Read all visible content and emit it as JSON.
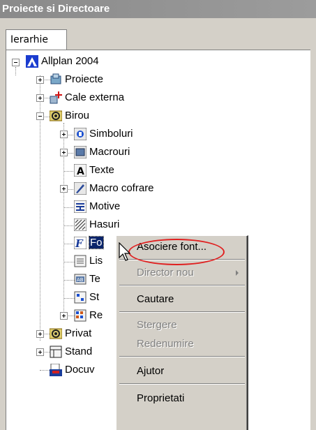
{
  "window": {
    "title": "Proiecte si Directoare"
  },
  "tabs": [
    {
      "label": "Ierarhie"
    }
  ],
  "tree": {
    "root": {
      "label": "Allplan 2004",
      "icon": "allplan-icon"
    },
    "items": [
      {
        "label": "Proiecte",
        "icon": "projects-icon"
      },
      {
        "label": "Cale externa",
        "icon": "external-path-icon"
      },
      {
        "label": "Birou",
        "icon": "office-icon"
      },
      {
        "label": "Simboluri",
        "icon": "symbols-icon"
      },
      {
        "label": "Macrouri",
        "icon": "macros-icon"
      },
      {
        "label": "Texte",
        "icon": "texts-icon"
      },
      {
        "label": "Macro cofrare",
        "icon": "formwork-macro-icon"
      },
      {
        "label": "Motive",
        "icon": "patterns-icon"
      },
      {
        "label": "Hasuri",
        "icon": "hatching-icon"
      },
      {
        "label": "Fo",
        "icon": "fonts-icon"
      },
      {
        "label": "Lis",
        "icon": "lists-icon"
      },
      {
        "label": "Te",
        "icon": "templates-icon"
      },
      {
        "label": "St",
        "icon": "styles-icon"
      },
      {
        "label": "Re",
        "icon": "reports-icon"
      },
      {
        "label": "Privat",
        "icon": "private-icon"
      },
      {
        "label": "Stand",
        "icon": "standard-icon"
      },
      {
        "label": "Docuv",
        "icon": "documents-icon"
      }
    ]
  },
  "context_menu": {
    "items": [
      {
        "label": "Asociere font...",
        "enabled": true
      },
      {
        "label": "Director nou",
        "enabled": false,
        "submenu": true
      },
      {
        "label": "Cautare",
        "enabled": true
      },
      {
        "label": "Stergere",
        "enabled": false
      },
      {
        "label": "Redenumire",
        "enabled": false
      },
      {
        "label": "Ajutor",
        "enabled": true
      },
      {
        "label": "Proprietati",
        "enabled": true
      }
    ]
  },
  "colors": {
    "highlight_ellipse": "#e02020",
    "selection": "#0a246a"
  }
}
